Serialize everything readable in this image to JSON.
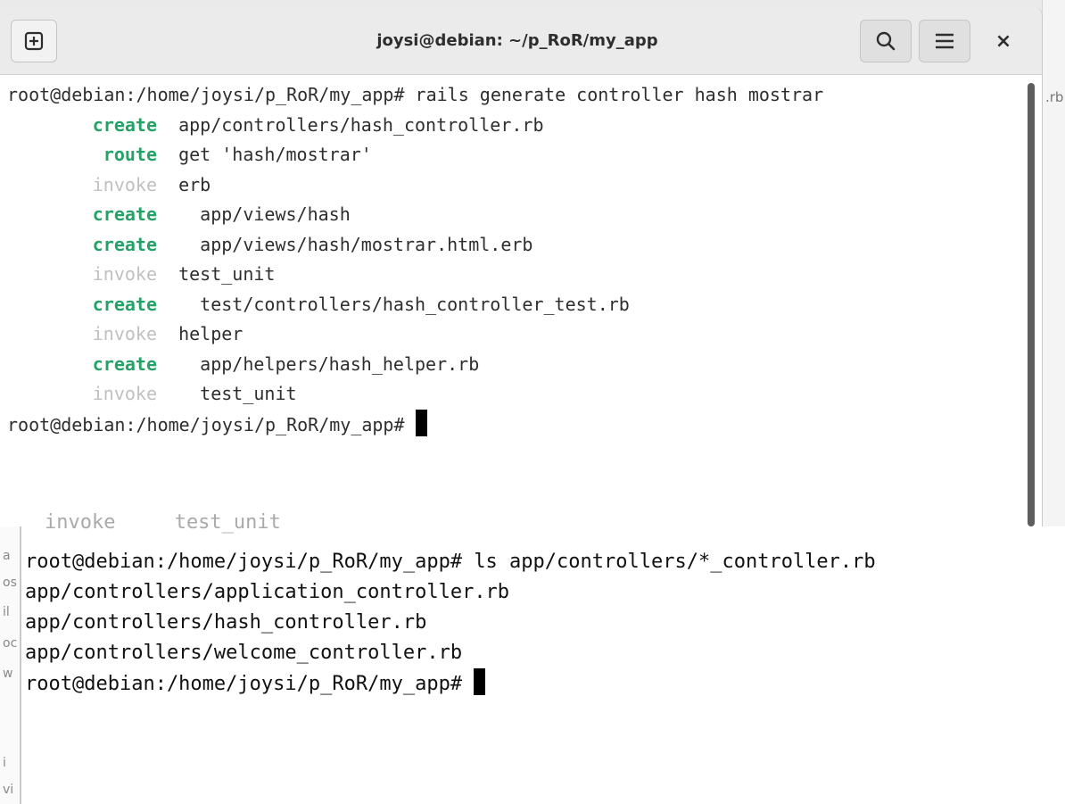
{
  "window": {
    "title": "joysi@debian: ~/p_RoR/my_app"
  },
  "background": {
    "peek_text": ".rb"
  },
  "terminal_top": {
    "command_line": "root@debian:/home/joysi/p_RoR/my_app# rails generate controller hash mostrar",
    "output": [
      {
        "tag": "create",
        "text": "app/controllers/hash_controller.rb"
      },
      {
        "tag": "route",
        "text": "get 'hash/mostrar'"
      },
      {
        "tag": "invoke",
        "text": "erb"
      },
      {
        "tag": "create",
        "text": "  app/views/hash"
      },
      {
        "tag": "create",
        "text": "  app/views/hash/mostrar.html.erb"
      },
      {
        "tag": "invoke",
        "text": "test_unit"
      },
      {
        "tag": "create",
        "text": "  test/controllers/hash_controller_test.rb"
      },
      {
        "tag": "invoke",
        "text": "helper"
      },
      {
        "tag": "create",
        "text": "  app/helpers/hash_helper.rb"
      },
      {
        "tag": "invoke",
        "text": "  test_unit"
      }
    ],
    "prompt": "root@debian:/home/joysi/p_RoR/my_app# "
  },
  "terminal_bottom": {
    "cut_line": "invoke     test_unit",
    "lines": [
      "root@debian:/home/joysi/p_RoR/my_app# ls app/controllers/*_controller.rb",
      "app/controllers/application_controller.rb",
      "app/controllers/hash_controller.rb",
      "app/controllers/welcome_controller.rb"
    ],
    "prompt": "root@debian:/home/joysi/p_RoR/my_app# ",
    "left_strip_chars": [
      "a",
      "os",
      "il",
      "oc",
      "w",
      "i",
      "vi"
    ]
  },
  "colors": {
    "create": "#26a269",
    "invoke": "#c0c0c0",
    "headerbar": "#ebebeb"
  },
  "icons": [
    "new-tab-icon",
    "search-icon",
    "hamburger-menu-icon",
    "close-icon"
  ]
}
